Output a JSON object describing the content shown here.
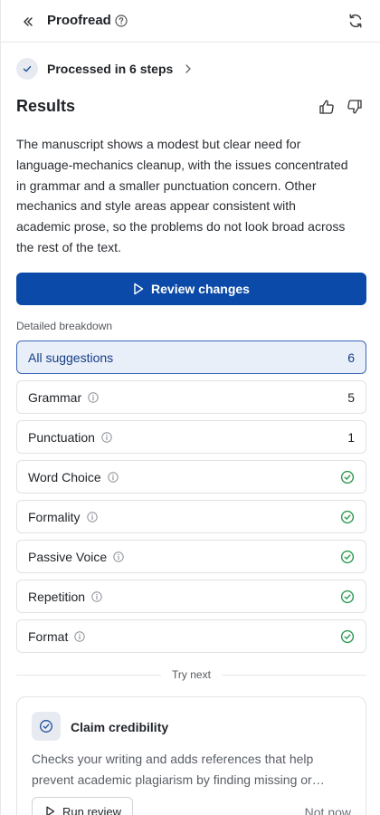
{
  "header": {
    "collapse_icon": "double-chevron-left-icon",
    "title": "Proofread",
    "help_icon": "question-circle-icon",
    "refresh_icon": "refresh-icon"
  },
  "processed": {
    "label": "Processed in 6 steps",
    "icon": "check-icon",
    "chevron_icon": "chevron-right-icon"
  },
  "results": {
    "title": "Results",
    "summary": "The manuscript shows a modest but clear need for language-mechanics cleanup, with the issues concentrated in grammar and a smaller punctuation concern. Other mechanics and style areas appear consistent with academic prose, so the problems do not look broad across the rest of the text."
  },
  "review_button": {
    "label": "Review changes",
    "icon": "play-icon"
  },
  "breakdown": {
    "label": "Detailed breakdown",
    "items": [
      {
        "label": "All suggestions",
        "count": "6",
        "active": true,
        "info": false
      },
      {
        "label": "Grammar",
        "count": "5",
        "info": true
      },
      {
        "label": "Punctuation",
        "count": "1",
        "info": true
      },
      {
        "label": "Word Choice",
        "status": "ok",
        "info": true
      },
      {
        "label": "Formality",
        "status": "ok",
        "info": true
      },
      {
        "label": "Passive Voice",
        "status": "ok",
        "info": true
      },
      {
        "label": "Repetition",
        "status": "ok",
        "info": true
      },
      {
        "label": "Format",
        "status": "ok",
        "info": true
      }
    ]
  },
  "try_next": {
    "label": "Try next",
    "card": {
      "title": "Claim credibility",
      "icon": "check-circle-icon",
      "description": "Checks your writing and adds references that help prevent academic plagiarism by finding missing or…",
      "run_label": "Run review",
      "dismiss_label": "Not now"
    }
  },
  "colors": {
    "accent": "#0b4aa8",
    "active_bg": "#e8eff9",
    "success": "#2e9a4f"
  }
}
